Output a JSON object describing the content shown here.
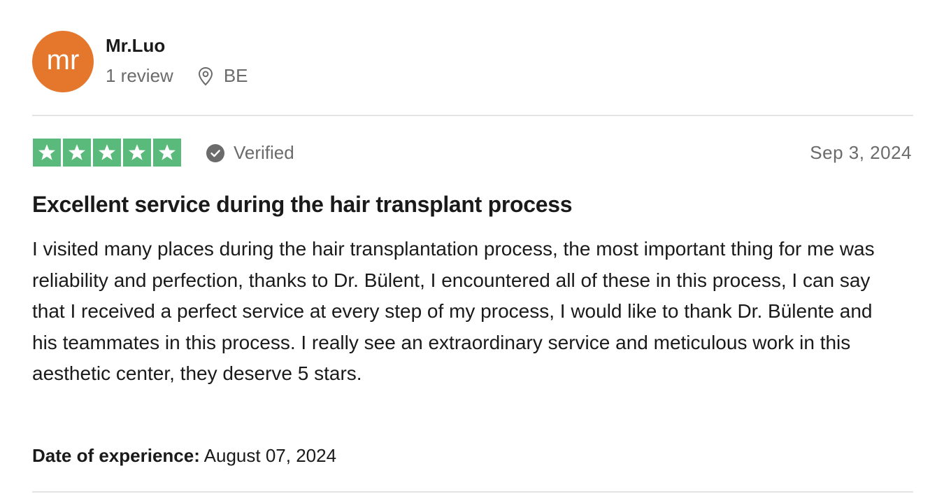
{
  "consumer": {
    "initials": "mr",
    "name": "Mr.Luo",
    "review_count": "1 review",
    "location": "BE",
    "avatar_color": "#e5772c"
  },
  "review": {
    "rating": 5,
    "max_rating": 5,
    "star_color": "#5aba7b",
    "verified_label": "Verified",
    "date": "Sep 3, 2024",
    "title": "Excellent service during the hair transplant process",
    "body": "I visited many places during the hair transplantation process, the most important thing for me was reliability and perfection, thanks to Dr. Bülent, I encountered all of these in this process, I can say that I received a perfect service at every step of my process, I would like to thank Dr. Bülente and his teammates in this process. I really see an extraordinary service and meticulous work in this aesthetic center, they deserve 5 stars.",
    "experience_label": "Date of experience:",
    "experience_date": "August 07, 2024"
  },
  "icons": {
    "location": "location-pin-icon",
    "verified": "check-circle-icon",
    "star": "star-icon"
  }
}
